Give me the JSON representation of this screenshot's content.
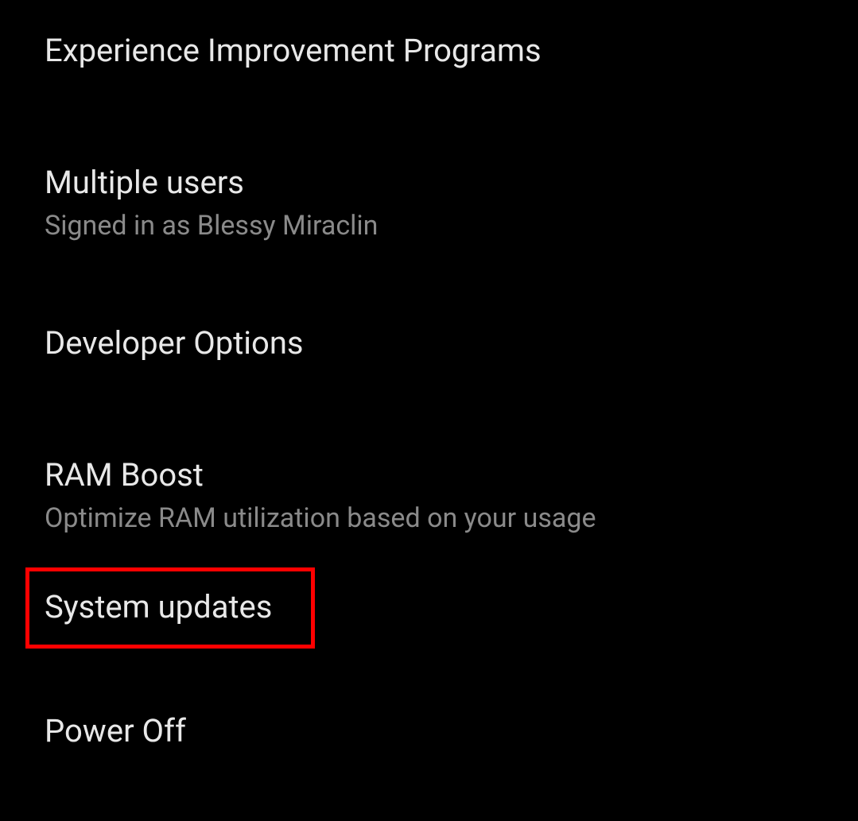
{
  "settings": {
    "items": [
      {
        "title": "Experience Improvement Programs",
        "subtitle": null
      },
      {
        "title": "Multiple users",
        "subtitle": "Signed in as Blessy Miraclin"
      },
      {
        "title": "Developer Options",
        "subtitle": null
      },
      {
        "title": "RAM Boost",
        "subtitle": "Optimize RAM utilization based on your usage"
      },
      {
        "title": "System updates",
        "subtitle": null
      },
      {
        "title": "Power Off",
        "subtitle": null
      }
    ]
  }
}
